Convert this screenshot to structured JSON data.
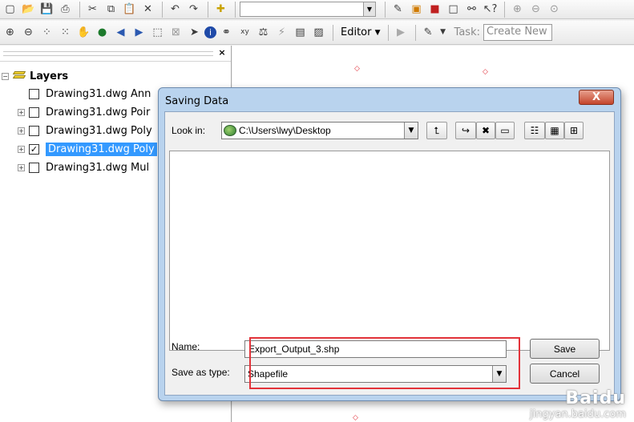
{
  "toolbar": {
    "editor_label": "Editor",
    "task_label": "Task:",
    "task_value": "Create New"
  },
  "toc": {
    "root_label": "Layers",
    "layers": [
      {
        "label": "Drawing31.dwg Ann",
        "checked": false,
        "expandable": false,
        "selected": false
      },
      {
        "label": "Drawing31.dwg Poir",
        "checked": false,
        "expandable": true,
        "selected": false
      },
      {
        "label": "Drawing31.dwg Poly",
        "checked": false,
        "expandable": true,
        "selected": false
      },
      {
        "label": "Drawing31.dwg Poly",
        "checked": true,
        "expandable": true,
        "selected": true
      },
      {
        "label": "Drawing31.dwg Mul",
        "checked": false,
        "expandable": true,
        "selected": false
      }
    ]
  },
  "dialog": {
    "title": "Saving Data",
    "close_label": "X",
    "look_in_label": "Look in:",
    "look_in_value": "C:\\Users\\lwy\\Desktop",
    "name_label": "Name:",
    "name_value": "Export_Output_3.shp",
    "save_as_type_label": "Save as type:",
    "save_as_type_value": "Shapefile",
    "save_button": "Save",
    "cancel_button": "Cancel"
  },
  "watermark": {
    "logo": "Baidu",
    "url": "jingyan.baidu.com"
  },
  "colors": {
    "highlight_box": "#e3333a",
    "selection": "#3399ff",
    "dialog_frame": "#b9d3ee"
  }
}
